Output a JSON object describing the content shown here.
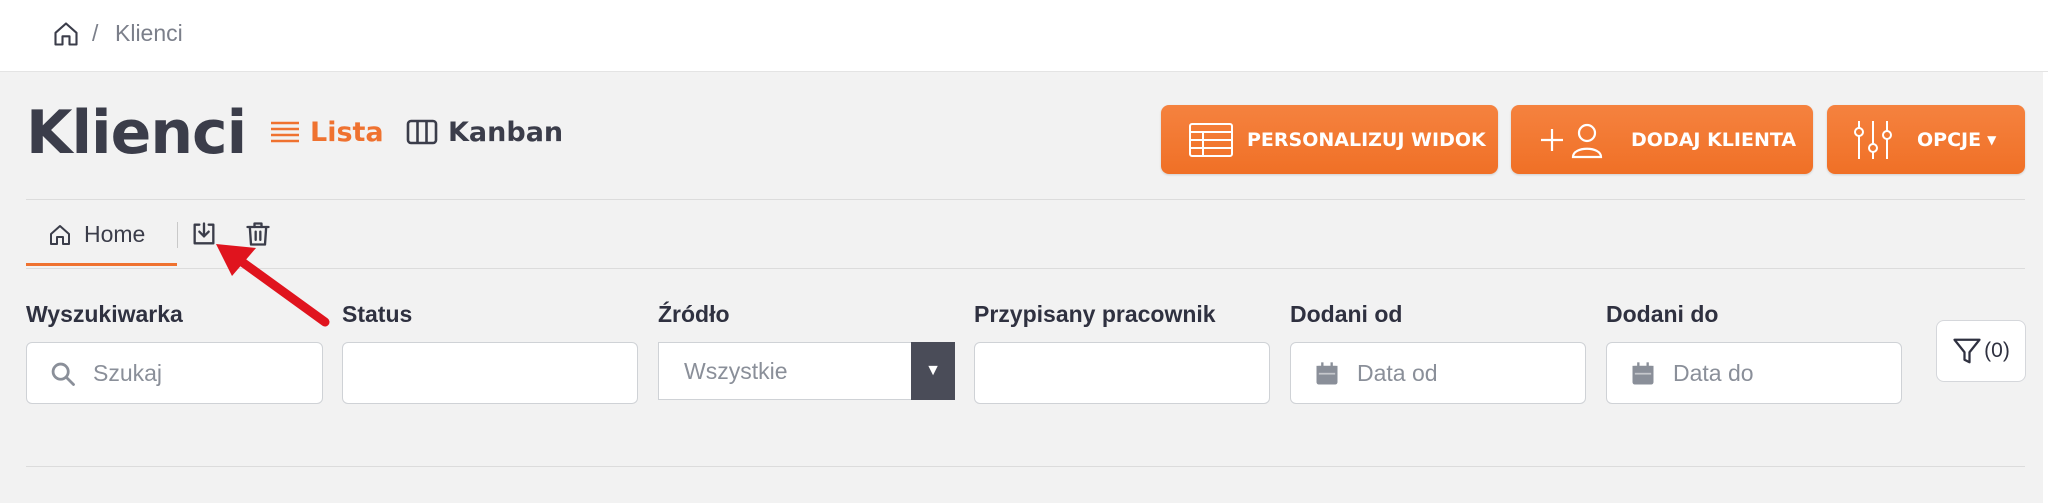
{
  "breadcrumb": {
    "separator": "/",
    "current": "Klienci"
  },
  "page": {
    "title": "Klienci"
  },
  "views": {
    "list_label": "Lista",
    "kanban_label": "Kanban"
  },
  "actions": {
    "personalize_label": "PERSONALIZUJ WIDOK",
    "add_client_label": "DODAJ KLIENTA",
    "options_label": "OPCJE"
  },
  "tabs": {
    "home_label": "Home"
  },
  "filters": {
    "search": {
      "label": "Wyszukiwarka",
      "placeholder": "Szukaj"
    },
    "status": {
      "label": "Status"
    },
    "source": {
      "label": "Źródło",
      "value": "Wszystkie"
    },
    "employee": {
      "label": "Przypisany pracownik"
    },
    "date_from": {
      "label": "Dodani od",
      "placeholder": "Data od"
    },
    "date_to": {
      "label": "Dodani do",
      "placeholder": "Data do"
    },
    "filter_count": "(0)"
  },
  "colors": {
    "accent": "#ef7230",
    "text": "#3b3d4a",
    "arrow": "#e0141e"
  },
  "icons": [
    "home-icon",
    "list-icon",
    "kanban-icon",
    "table-icon",
    "add-user-icon",
    "sliders-icon",
    "download-icon",
    "trash-icon",
    "search-icon",
    "calendar-icon",
    "funnel-icon"
  ]
}
